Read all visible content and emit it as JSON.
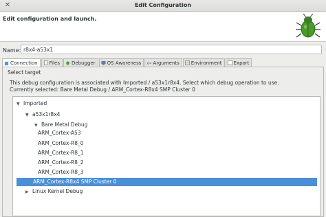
{
  "window": {
    "title": "Edit Configuration"
  },
  "header": {
    "heading": "Edit configuration and launch."
  },
  "name_field": {
    "label": "Name:",
    "value": "r8x4-a53x1"
  },
  "tabs": [
    {
      "label": "Connection",
      "icon": "connection-icon",
      "active": true
    },
    {
      "label": "Files",
      "icon": "files-icon"
    },
    {
      "label": "Debugger",
      "icon": "debugger-icon"
    },
    {
      "label": "OS Awareness",
      "icon": "os-awareness-icon"
    },
    {
      "label": "Arguments",
      "icon": "arguments-icon"
    },
    {
      "label": "Environment",
      "icon": "environment-icon"
    },
    {
      "label": "Export",
      "icon": "export-icon"
    }
  ],
  "panel": {
    "group_label": "Select target",
    "desc_line1": "This debug configuration is associated with Imported / a53x1r8x4. Select which debug operation to use.",
    "desc_line2": "Currently selected: Bare Metal Debug / ARM_Cortex-R8x4 SMP Cluster 0"
  },
  "tree": {
    "imported": "Imported",
    "a53x1r8x4": "a53x1r8x4",
    "bare_metal": "Bare Metal Debug",
    "items": [
      "ARM_Cortex-A53",
      "ARM_Cortex-R8_0",
      "ARM_Cortex-R8_1",
      "ARM_Cortex-R8_2",
      "ARM_Cortex-R8_3",
      "ARM_Cortex-R8x4 SMP Cluster 0"
    ],
    "linux": "Linux Kernel Debug",
    "selected_color": "#4a90d9"
  }
}
